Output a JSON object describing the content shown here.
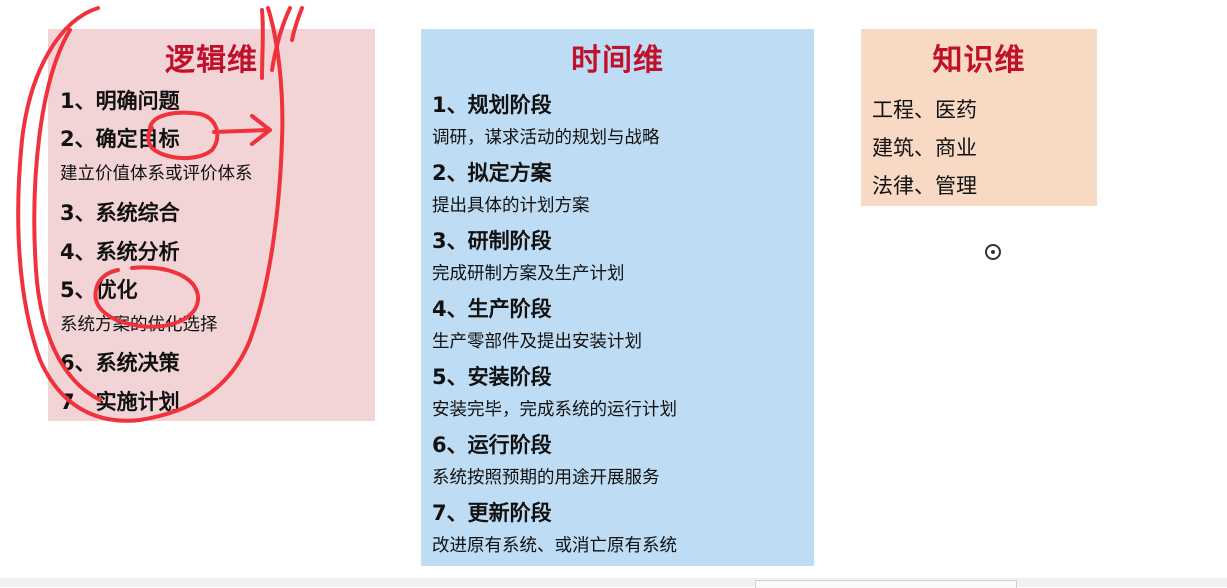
{
  "logic_panel": {
    "title": "逻辑维",
    "items": [
      {
        "label": "1、明确问题"
      },
      {
        "label": "2、确定目标",
        "desc": "建立价值体系或评价体系"
      },
      {
        "label": "3、系统综合"
      },
      {
        "label": "4、系统分析"
      },
      {
        "label": "5、优化",
        "desc": "系统方案的优化选择"
      },
      {
        "label": "6、系统决策"
      },
      {
        "label": "7、实施计划"
      }
    ]
  },
  "time_panel": {
    "title": "时间维",
    "items": [
      {
        "label": "1、规划阶段",
        "desc": "调研，谋求活动的规划与战略"
      },
      {
        "label": "2、拟定方案",
        "desc": "提出具体的计划方案"
      },
      {
        "label": "3、研制阶段",
        "desc": "完成研制方案及生产计划"
      },
      {
        "label": "4、生产阶段",
        "desc": "生产零部件及提出安装计划"
      },
      {
        "label": "5、安装阶段",
        "desc": "安装完毕，完成系统的运行计划"
      },
      {
        "label": "6、运行阶段",
        "desc": "系统按照预期的用途开展服务"
      },
      {
        "label": "7、更新阶段",
        "desc": "改进原有系统、或消亡原有系统"
      }
    ]
  },
  "knowledge_panel": {
    "title": "知识维",
    "items": [
      "工程、医药",
      "建筑、商业",
      "法律、管理"
    ]
  },
  "colors": {
    "logic_bg": "#f2d3d6",
    "time_bg": "#bedcf3",
    "knowledge_bg": "#f8d9c3",
    "title_red": "#c0102c",
    "annotation_red": "#f0323c"
  },
  "cursor_icon": "circle-dot-icon"
}
